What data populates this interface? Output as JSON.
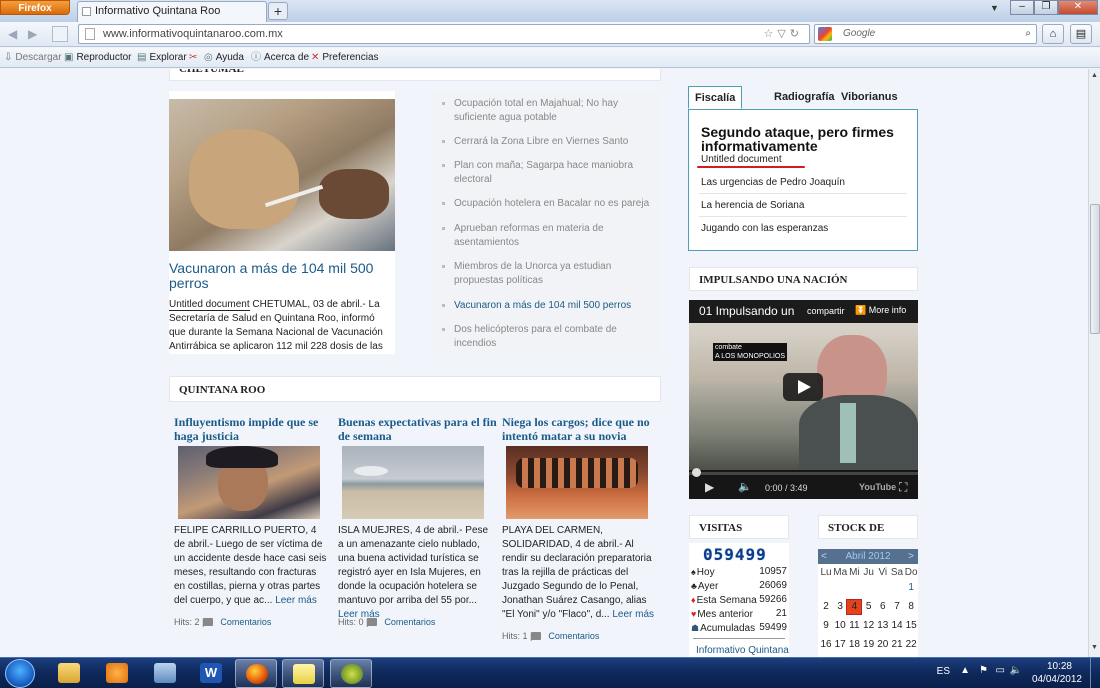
{
  "browser": {
    "app_button": "Firefox",
    "tab_title": "Informativo Quintana Roo",
    "new_tab": "+",
    "url": "www.informativoquintanaroo.com.mx",
    "search_placeholder": "Google",
    "toolbar": {
      "descargar": "Descargar",
      "reproductor": "Reproductor",
      "explorar": "Explorar",
      "ayuda": "Ayuda",
      "acerca": "Acerca de",
      "preferencias": "Preferencias"
    }
  },
  "page": {
    "chetumal_header": "CHETUMAL",
    "featured": {
      "title": "Vacunaron a más de 104 mil 500 perros",
      "untitled": "Untitled document",
      "body": " CHETUMAL, 03 de abril.- La Secretaría de Salud en Quintana Roo, informó que durante la Semana Nacional de Vacunación Antirrábica se aplicaron 112 mil 228 dosis de las"
    },
    "chetumal_list": [
      "Ocupación total en Majahual; No hay suficiente agua potable",
      "Cerrará la Zona Libre en Viernes Santo",
      "Plan con maña; Sagarpa hace maniobra electoral",
      "Ocupación hotelera en Bacalar no es pareja",
      "Aprueban reformas en materia de asentamientos",
      "Miembros de la Unorca ya estudian propuestas políticas",
      "Vacunaron a más de 104 mil 500 perros",
      "Dos helicópteros para el combate de incendios"
    ],
    "quintana_header": "QUINTANA ROO",
    "articles": [
      {
        "title": "Influyentismo impide que se haga justicia",
        "body": "FELIPE CARRILLO PUERTO, 4 de abril.- Luego de ser víctima de un accidente desde hace casi seis meses, resultando con fracturas en costillas, pierna y otras partes del cuerpo, y que ac...",
        "more": "Leer más",
        "hits": "Hits: 2 |",
        "comments": "Comentarios"
      },
      {
        "title": "Buenas expectativas para el fin de semana",
        "body": "ISLA MUEJRES, 4 de abril.- Pese a un amenazante cielo nublado, una buena actividad turística se registró ayer en Isla Mujeres, en donde la ocupación hotelera se mantuvo por arriba del 55 por...",
        "more": "Leer más",
        "hits": "Hits: 0 |",
        "comments": "Comentarios"
      },
      {
        "title": "Niega los cargos; dice que no intentó matar a su novia",
        "body": "PLAYA DEL CARMEN, SOLIDARIDAD, 4 de abril.- Al rendir su declaración preparatoria tras la rejilla de prácticas del Juzgado Segundo de lo Penal, Jonathan Suárez Casango, alias \"El Yoni\" y/o \"Flaco\", d...",
        "more": "Leer más",
        "hits": "Hits: 1 |",
        "comments": "Comentarios"
      }
    ]
  },
  "sidebar": {
    "tabs": [
      "Fiscalía Social",
      "Radiografía",
      "Viborianus"
    ],
    "headline": "Segundo ataque, pero firmes informativamente",
    "sub": "Untitled document",
    "links": [
      "Las urgencias de Pedro Joaquín",
      "La herencia de Soriana",
      "Jugando con las esperanzas"
    ],
    "video_header": "IMPULSANDO UNA NACIÓN PRODUCTIVA",
    "video": {
      "title": "01 Impulsando un",
      "share": "compartir",
      "more_info": "More info",
      "badge1": "combate",
      "badge2": "A LOS MONOPOLIOS",
      "time": "0:00 / 3:49",
      "brand": "YouTube"
    },
    "visitas_header": "VISITAS",
    "visitas": {
      "counter": "059499",
      "rows": [
        {
          "label": "Hoy",
          "value": "10957"
        },
        {
          "label": "Ayer",
          "value": "26069"
        },
        {
          "label": "Esta Semana",
          "value": "59266"
        },
        {
          "label": "Mes anterior",
          "value": "21"
        },
        {
          "label": "Acumuladas",
          "value": "59499"
        }
      ],
      "footer": "Informativo Quintana"
    },
    "stock_header": "STOCK DE",
    "calendar": {
      "month": "Abril 2012",
      "prev": "<",
      "next": ">",
      "weekdays": [
        "Lu",
        "Ma",
        "Mi",
        "Ju",
        "Vi",
        "Sa",
        "Do"
      ],
      "rows": [
        [
          "",
          "",
          "",
          "",
          "",
          "",
          "1"
        ],
        [
          "2",
          "3",
          "4",
          "5",
          "6",
          "7",
          "8"
        ],
        [
          "9",
          "10",
          "11",
          "12",
          "13",
          "14",
          "15"
        ],
        [
          "16",
          "17",
          "18",
          "19",
          "20",
          "21",
          "22"
        ]
      ],
      "today": "4"
    }
  },
  "taskbar": {
    "lang": "ES",
    "time": "10:28",
    "date": "04/04/2012"
  },
  "colors": {
    "link": "#1b5b88",
    "accent_border": "#4e9fb6",
    "today": "#e2431a"
  }
}
